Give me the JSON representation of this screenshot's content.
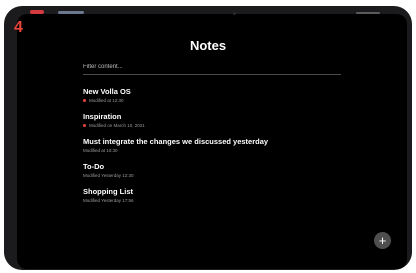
{
  "app": {
    "logo_glyph": "4",
    "logo_color": "#e8453c"
  },
  "header": {
    "title": "Notes"
  },
  "filter": {
    "placeholder": "Filter content..."
  },
  "notes": [
    {
      "title": "New Volla OS",
      "meta": "Modified at 12:30",
      "pinned": true
    },
    {
      "title": "Inspiration",
      "meta": "Modified on March 10, 2021",
      "pinned": true
    },
    {
      "title": "Must integrate the changes we discussed yesterday",
      "meta": "Modified at 10:30",
      "pinned": false
    },
    {
      "title": "To-Do",
      "meta": "Modified Yesterday 12:30",
      "pinned": false
    },
    {
      "title": "Shopping List",
      "meta": "Modified Yesterday 17:56",
      "pinned": false
    }
  ],
  "fab": {
    "icon": "plus-icon",
    "glyph": "+"
  },
  "colors": {
    "background": "#000000",
    "bezel": "#1b1b1d",
    "accent": "#e8453c",
    "fab": "#4e4e4e"
  }
}
